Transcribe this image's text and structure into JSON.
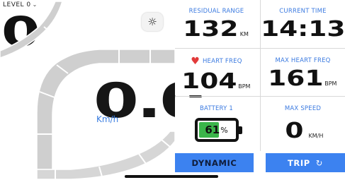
{
  "status": {
    "level_label": "LEVEL 0",
    "level_chevron": "⌄",
    "assist_value": "0"
  },
  "controls": {
    "light_icon": "sun-icon",
    "light_glyph": "☼"
  },
  "speedometer": {
    "speed": "0.0",
    "unit": "Km/h"
  },
  "stats": {
    "residual_range": {
      "label": "RESIDUAL RANGE",
      "value": "132",
      "unit": "KM"
    },
    "current_time": {
      "label": "CURRENT TIME",
      "value": "14:13"
    },
    "heart_freq": {
      "label": "HEART FREQ",
      "value": "104",
      "unit": "BPM",
      "icon": "heart-icon",
      "glyph": "♥"
    },
    "max_heart_freq": {
      "label": "MAX HEART FREQ",
      "value": "161",
      "unit": "BPM"
    },
    "battery": {
      "label": "BATTERY 1",
      "value": "61",
      "unit": "%",
      "level": 0.61
    },
    "max_speed": {
      "label": "MAX SPEED",
      "value": "0",
      "unit": "KM/H"
    }
  },
  "buttons": {
    "dynamic": {
      "label": "DYNAMIC"
    },
    "trip": {
      "label": "TRIP",
      "icon": "refresh-icon",
      "glyph": "↻"
    }
  },
  "colors": {
    "accent": "#3c82f0",
    "label_blue": "#3b7ae0",
    "battery_green": "#3bb54a",
    "heart_red": "#e23a3a",
    "gauge_gray": "#cfcfcf"
  }
}
